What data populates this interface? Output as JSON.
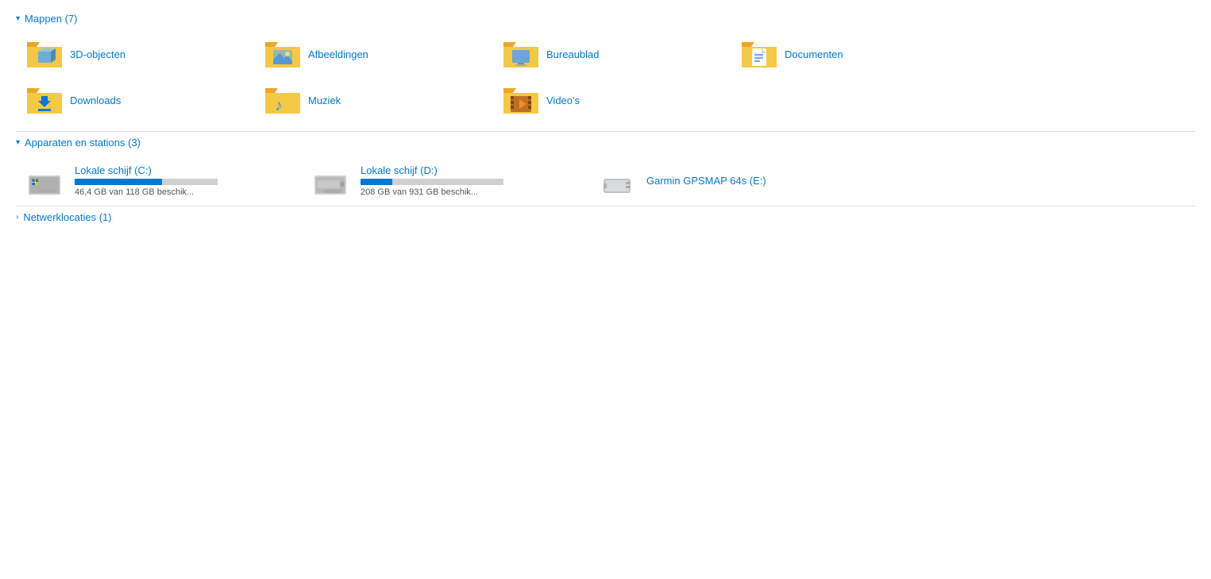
{
  "sections": {
    "folders": {
      "label": "Mappen (7)",
      "chevron": "▾",
      "items": [
        {
          "id": "3d-objecten",
          "name": "3D-objecten",
          "icon_type": "folder-3d"
        },
        {
          "id": "afbeeldingen",
          "name": "Afbeeldingen",
          "icon_type": "folder-pictures"
        },
        {
          "id": "bureaublad",
          "name": "Bureaublad",
          "icon_type": "folder-desktop"
        },
        {
          "id": "documenten",
          "name": "Documenten",
          "icon_type": "folder-documents"
        },
        {
          "id": "downloads",
          "name": "Downloads",
          "icon_type": "folder-downloads"
        },
        {
          "id": "muziek",
          "name": "Muziek",
          "icon_type": "folder-music"
        },
        {
          "id": "videos",
          "name": "Video's",
          "icon_type": "folder-videos"
        }
      ]
    },
    "devices": {
      "label": "Apparaten en stations (3)",
      "chevron": "▾",
      "items": [
        {
          "id": "drive-c",
          "name": "Lokale schijf (C:)",
          "icon_type": "drive-windows",
          "used_pct": 60,
          "bar_color": "blue",
          "capacity_text": "46,4 GB van 118 GB beschik..."
        },
        {
          "id": "drive-d",
          "name": "Lokale schijf (D:)",
          "icon_type": "drive-plain",
          "used_pct": 22,
          "bar_color": "blue",
          "capacity_text": "208 GB van 931 GB beschik..."
        },
        {
          "id": "drive-e",
          "name": "Garmin GPSMAP 64s (E:)",
          "icon_type": "drive-garmin",
          "used_pct": 0,
          "bar_color": null,
          "capacity_text": null
        }
      ]
    },
    "network": {
      "label": "Netwerklocaties (1)",
      "chevron": "›"
    }
  }
}
